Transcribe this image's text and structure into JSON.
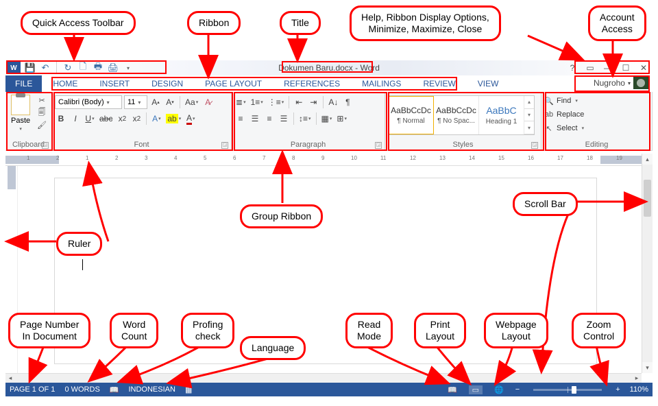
{
  "callouts": {
    "qat": "Quick Access Toolbar",
    "ribbon": "Ribbon",
    "title": "Title",
    "winctl": "Help, Ribbon Display Options,\nMinimize, Maximize, Close",
    "account": "Account\nAccess",
    "group": "Group Ribbon",
    "ruler": "Ruler",
    "scroll": "Scroll Bar",
    "pagenum": "Page Number\nIn Document",
    "wordcount": "Word\nCount",
    "proofing": "Profing\ncheck",
    "language": "Language",
    "readmode": "Read\nMode",
    "printlayout": "Print\nLayout",
    "weblayout": "Webpage\nLayout",
    "zoom": "Zoom\nControl"
  },
  "title": "Dokumen Baru.docx - Word",
  "tabs": {
    "file": "FILE",
    "items": [
      "HOME",
      "INSERT",
      "DESIGN",
      "PAGE LAYOUT",
      "REFERENCES",
      "MAILINGS",
      "REVIEW",
      "VIEW"
    ]
  },
  "account": {
    "name": "Nugroho"
  },
  "ribbon": {
    "clipboard": {
      "label": "Clipboard",
      "paste": "Paste"
    },
    "font": {
      "label": "Font",
      "family": "Calibri (Body)",
      "size": "11"
    },
    "paragraph": {
      "label": "Paragraph"
    },
    "styles": {
      "label": "Styles",
      "items": [
        {
          "preview": "AaBbCcDc",
          "name": "¶ Normal"
        },
        {
          "preview": "AaBbCcDc",
          "name": "¶ No Spac..."
        },
        {
          "preview": "AaBbC",
          "name": "Heading 1"
        }
      ]
    },
    "editing": {
      "label": "Editing",
      "find": "Find",
      "replace": "Replace",
      "select": "Select"
    }
  },
  "ruler_numbers": [
    "1",
    "2",
    "1",
    "2",
    "3",
    "4",
    "5",
    "6",
    "7",
    "8",
    "9",
    "10",
    "11",
    "12",
    "13",
    "14",
    "15",
    "16",
    "17",
    "18",
    "19"
  ],
  "status": {
    "page": "PAGE 1 OF 1",
    "words": "0 WORDS",
    "language": "INDONESIAN",
    "zoom": "110%"
  }
}
